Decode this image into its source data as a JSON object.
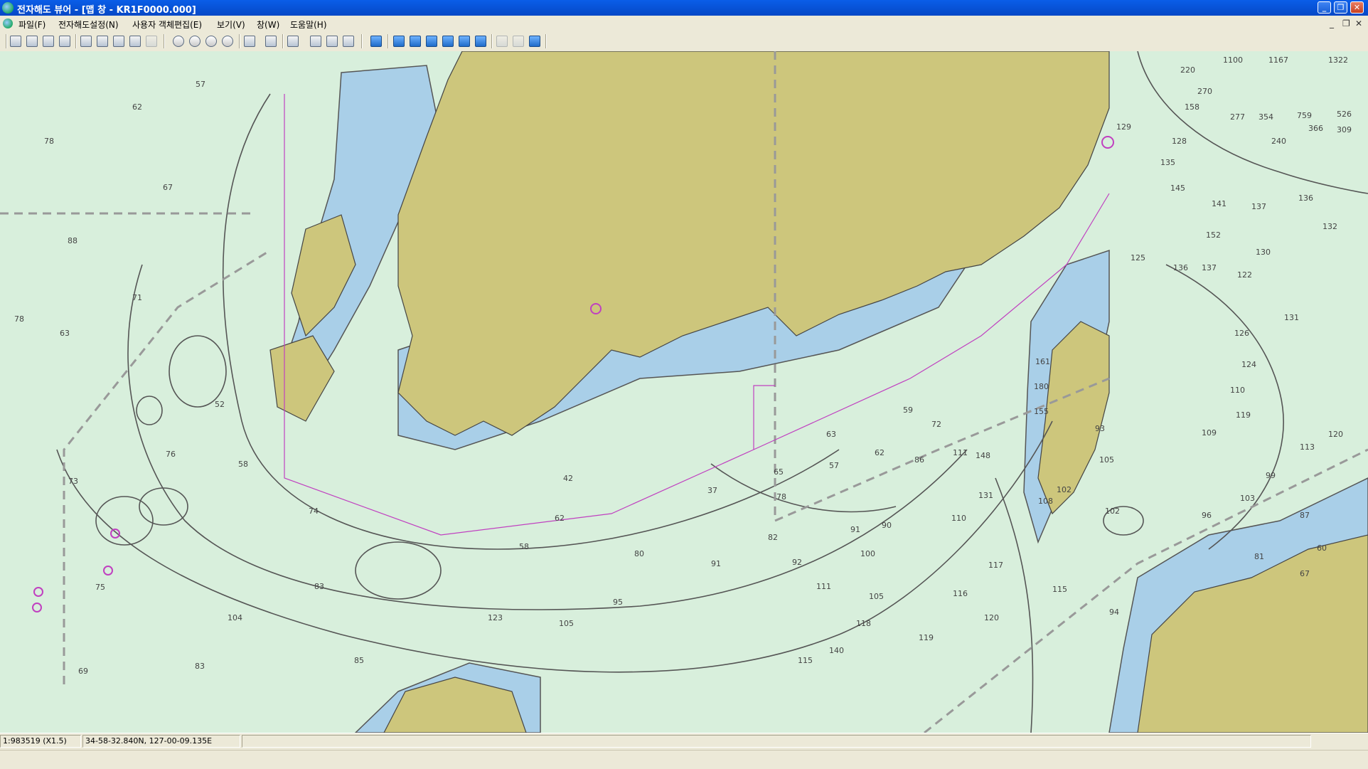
{
  "window": {
    "title": "전자해도 뷰어 - [맵 창 - KR1F0000.000]"
  },
  "menu": {
    "items": [
      "파일(F)",
      "전자해도설정(N)",
      "사용자 객체편집(E)",
      "보기(V)",
      "창(W)",
      "도움말(H)"
    ]
  },
  "map": {
    "depths": [
      {
        "v": "57"
      },
      {
        "v": "62"
      },
      {
        "v": "78"
      },
      {
        "v": "67"
      },
      {
        "v": "88"
      },
      {
        "v": "78"
      },
      {
        "v": "71"
      },
      {
        "v": "63"
      },
      {
        "v": "52"
      },
      {
        "v": "76"
      },
      {
        "v": "73"
      },
      {
        "v": "58"
      },
      {
        "v": "74"
      },
      {
        "v": "42"
      },
      {
        "v": "62"
      },
      {
        "v": "58"
      },
      {
        "v": "75"
      },
      {
        "v": "83"
      },
      {
        "v": "104"
      },
      {
        "v": "123"
      },
      {
        "v": "85"
      },
      {
        "v": "69"
      },
      {
        "v": "83"
      },
      {
        "v": "95"
      },
      {
        "v": "105"
      },
      {
        "v": "91"
      },
      {
        "v": "80"
      },
      {
        "v": "37"
      },
      {
        "v": "65"
      },
      {
        "v": "78"
      },
      {
        "v": "82"
      },
      {
        "v": "92"
      },
      {
        "v": "111"
      },
      {
        "v": "118"
      },
      {
        "v": "115"
      },
      {
        "v": "140"
      },
      {
        "v": "105"
      },
      {
        "v": "116"
      },
      {
        "v": "119"
      },
      {
        "v": "120"
      },
      {
        "v": "117"
      },
      {
        "v": "131"
      },
      {
        "v": "148"
      },
      {
        "v": "111"
      },
      {
        "v": "86"
      },
      {
        "v": "62"
      },
      {
        "v": "57"
      },
      {
        "v": "63"
      },
      {
        "v": "59"
      },
      {
        "v": "72"
      },
      {
        "v": "90"
      },
      {
        "v": "91"
      },
      {
        "v": "100"
      },
      {
        "v": "110"
      },
      {
        "v": "102"
      },
      {
        "v": "108"
      },
      {
        "v": "155"
      },
      {
        "v": "180"
      },
      {
        "v": "161"
      },
      {
        "v": "129"
      },
      {
        "v": "135"
      },
      {
        "v": "145"
      },
      {
        "v": "141"
      },
      {
        "v": "137"
      },
      {
        "v": "136"
      },
      {
        "v": "132"
      },
      {
        "v": "125"
      },
      {
        "v": "136"
      },
      {
        "v": "137"
      },
      {
        "v": "122"
      },
      {
        "v": "126"
      },
      {
        "v": "131"
      },
      {
        "v": "124"
      },
      {
        "v": "110"
      },
      {
        "v": "119"
      },
      {
        "v": "109"
      },
      {
        "v": "120"
      },
      {
        "v": "113"
      },
      {
        "v": "99"
      },
      {
        "v": "103"
      },
      {
        "v": "96"
      },
      {
        "v": "87"
      },
      {
        "v": "81"
      },
      {
        "v": "67"
      },
      {
        "v": "60"
      },
      {
        "v": "1100"
      },
      {
        "v": "1167"
      },
      {
        "v": "1322"
      },
      {
        "v": "220"
      },
      {
        "v": "270"
      },
      {
        "v": "158"
      },
      {
        "v": "277"
      },
      {
        "v": "354"
      },
      {
        "v": "759"
      },
      {
        "v": "526"
      },
      {
        "v": "366"
      },
      {
        "v": "309"
      },
      {
        "v": "240"
      },
      {
        "v": "128"
      },
      {
        "v": "152"
      },
      {
        "v": "130"
      },
      {
        "v": "93"
      },
      {
        "v": "105"
      },
      {
        "v": "102"
      },
      {
        "v": "115"
      },
      {
        "v": "94"
      }
    ]
  },
  "status": {
    "scale": "1:983519 (X1.5)",
    "coords": "34-58-32.840N, 127-00-09.135E",
    "message": ""
  },
  "colors": {
    "land": "#cdc67c",
    "shallow": "#a9cfe8",
    "sea": "#d8efdc",
    "contour": "#555555",
    "route": "#c040c0"
  }
}
